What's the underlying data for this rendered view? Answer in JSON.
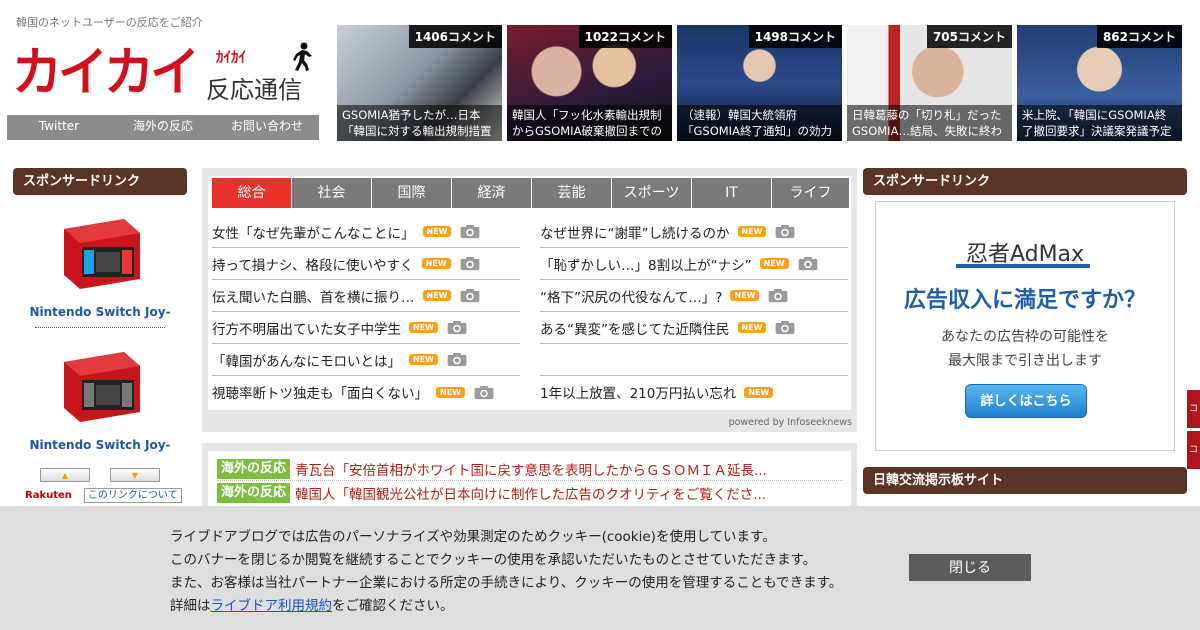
{
  "header": {
    "tagline": "韓国のネットユーザーの反応をご紹介",
    "logo_main": "カイカイ",
    "logo_kana": "ｶｲｶｲ",
    "logo_sub": "反応通信",
    "nav": [
      "Twitter",
      "海外の反応",
      "お問い合わせ"
    ]
  },
  "thumbs": [
    {
      "count": "1406コメント",
      "caption": "GSOMIA猶予したが…日本「韓国に対する輸出規制措置",
      "bg": "#5d6b78"
    },
    {
      "count": "1022コメント",
      "caption": "韓国人「フッ化水素輸出規制からGSOMIA破棄撤回までの",
      "bg": "#4a3a45"
    },
    {
      "count": "1498コメント",
      "caption": "（速報）韓国大統領府「GSOMIA終了通知」の効力",
      "bg": "#2b3f66"
    },
    {
      "count": "705コメント",
      "caption": "日韓葛藤の「切り札」だったGSOMIA…結局、失敗に終わ",
      "bg": "#6a5b52"
    },
    {
      "count": "862コメント",
      "caption": "米上院、「韓国にGSOMIA終了撤回要求」決議案発議予定",
      "bg": "#2a4a78"
    }
  ],
  "left_sidebar": {
    "title": "スポンサードリンク",
    "products": [
      {
        "name": "Nintendo Switch Joy-"
      },
      {
        "name": "Nintendo Switch Joy-"
      }
    ],
    "rakuten": "Rakuten",
    "link_about": "このリンクについて"
  },
  "main": {
    "tabs": [
      "総合",
      "社会",
      "国際",
      "経済",
      "芸能",
      "スポーツ",
      "IT",
      "ライフ"
    ],
    "active_tab": "総合",
    "news_left": [
      {
        "text": "女性「なぜ先輩がこんなことに」",
        "badge": "NEW",
        "cam": true
      },
      {
        "text": "持って損ナシ、格段に使いやすく",
        "badge": "NEW",
        "cam": true
      },
      {
        "text": "伝え聞いた白鵬、首を横に振り…",
        "badge": "NEW",
        "cam": true
      },
      {
        "text": "行方不明届出ていた女子中学生",
        "badge": "NEW",
        "cam": true
      },
      {
        "text": "「韓国があんなにモロいとは」",
        "badge": "NEW",
        "cam": true
      },
      {
        "text": "視聴率断トツ独走も「面白くない」",
        "badge": "NEW",
        "cam": true
      }
    ],
    "news_right": [
      {
        "text": "なぜ世界に“謝罪”し続けるのか",
        "badge": "NEW",
        "cam": true
      },
      {
        "text": "「恥ずかしい…」8割以上が“ナシ”",
        "badge": "NEW",
        "cam": true
      },
      {
        "text": "“格下”沢尻の代役なんて…」?",
        "badge": "NEW",
        "cam": true
      },
      {
        "text": "ある“異変”を感じてた近隣住民",
        "badge": "NEW",
        "cam": true
      },
      {
        "text": "",
        "badge": "",
        "cam": false
      },
      {
        "text": "1年以上放置、210万円払い忘れ",
        "badge": "NEW",
        "cam": false
      }
    ],
    "powered": "powered by Infoseeknews"
  },
  "reactions": [
    {
      "tag": "海外の反応",
      "text": "青瓦台「安倍首相がホワイト国に戻す意思を表明したからＧＳＯＭＩＡ延長..."
    },
    {
      "tag": "海外の反応",
      "text": "韓国人「韓国観光公社が日本向けに制作した広告のクオリティをご覧くださ..."
    }
  ],
  "right_sidebar": {
    "title": "スポンサードリンク",
    "ad": {
      "brand": "忍者AdMax",
      "headline": "広告収入に満足ですか？",
      "body1": "あなたの広告枠の可能性を",
      "body2": "最大限まで引き出します",
      "button": "詳しくはこちら"
    },
    "title2": "日韓交流掲示板サイト"
  },
  "side_tabs": [
    "コ",
    "コ"
  ],
  "cookie": {
    "line1": "ライブドアブログでは広告のパーソナライズや効果測定のためクッキー(cookie)を使用しています。",
    "line2": "このバナーを閉じるか閲覧を継続することでクッキーの使用を承認いただいたものとさせていただきます。",
    "line3": "また、お客様は当社パートナー企業における所定の手続きにより、クッキーの使用を管理することもできます。",
    "line4_pre": "詳細は",
    "line4_link": "ライブドア利用規約",
    "line4_post": "をご確認ください。",
    "close": "閉じる"
  },
  "colors": {
    "brand_red": "#d0111b",
    "sidebar_brown": "#5b3426",
    "tab_active": "#e8322c",
    "reaction_green": "#7fbf3f"
  }
}
